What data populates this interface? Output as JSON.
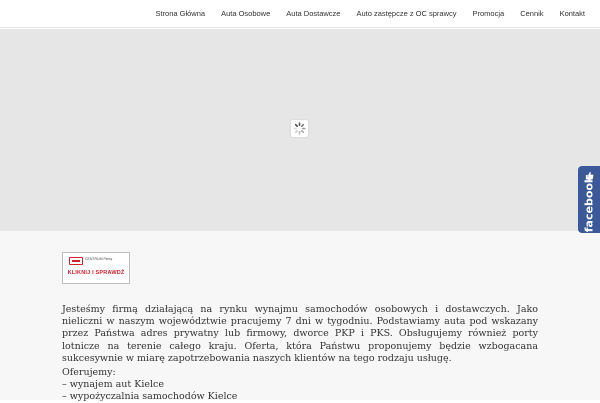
{
  "nav": {
    "items": [
      {
        "label": "Strona Główna"
      },
      {
        "label": "Auta Osobowe"
      },
      {
        "label": "Auta Dostawcze"
      },
      {
        "label": "Auto zastępcze z OC sprawcy"
      },
      {
        "label": "Promocja"
      },
      {
        "label": "Cennik"
      },
      {
        "label": "Kontakt"
      }
    ]
  },
  "slider": {
    "state": "loading",
    "background_color": "#e6e6e6"
  },
  "banner": {
    "brand": "CENTRUM Firmy",
    "cta": "KLIKNIJ I SPRAWDŹ",
    "accent_color": "#d11f2e"
  },
  "content": {
    "intro": "Jesteśmy firmą działającą na rynku wynajmu samochodów osobowych i dostawczych. Jako nieliczni w naszym województwie pracujemy 7 dni w tygodniu. Podstawiamy auta pod wskazany przez Państwa adres prywatny lub firmowy, dworce PKP i PKS. Obsługujemy również porty lotnicze na terenie całego kraju. Oferta, która Państwu proponujemy będzie wzbogacana sukcesywnie w miarę zapotrzebowania naszych klientów na tego rodzaju usługę.",
    "offer_heading": "Oferujemy:",
    "offer_items": [
      "– wynajem aut Kielce",
      "– wypożyczalnia samochodów Kielce"
    ]
  },
  "facebook_tab": {
    "label": "facebook",
    "icon": "thumbs-up-icon",
    "color": "#3b5998"
  }
}
